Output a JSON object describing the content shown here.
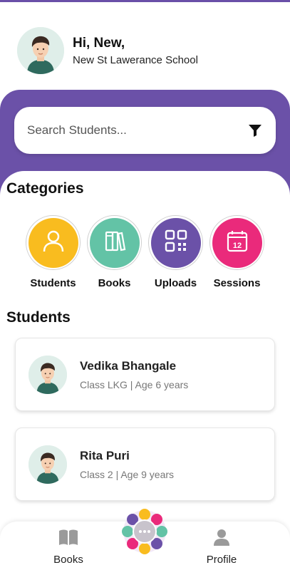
{
  "header": {
    "greeting": "Hi, New,",
    "school": "New St Lawerance School"
  },
  "search": {
    "placeholder": "Search Students..."
  },
  "categories": {
    "title": "Categories",
    "items": [
      {
        "label": "Students",
        "icon": "person-icon",
        "color": "#f9bc1f"
      },
      {
        "label": "Books",
        "icon": "books-icon",
        "color": "#63c3a6"
      },
      {
        "label": "Uploads",
        "icon": "qr-code-icon",
        "color": "#6b51a8"
      },
      {
        "label": "Sessions",
        "icon": "calendar-icon",
        "color": "#ea2a7b"
      }
    ]
  },
  "students": {
    "title": "Students",
    "items": [
      {
        "name": "Vedika Bhangale",
        "info": "Class LKG | Age 6 years"
      },
      {
        "name": "Rita Puri",
        "info": "Class 2 | Age 9 years"
      }
    ]
  },
  "bottom_nav": {
    "books_label": "Books",
    "profile_label": "Profile"
  },
  "colors": {
    "primary": "#6b51a8",
    "students": "#f9bc1f",
    "books": "#63c3a6",
    "uploads": "#6b51a8",
    "sessions": "#ea2a7b"
  }
}
